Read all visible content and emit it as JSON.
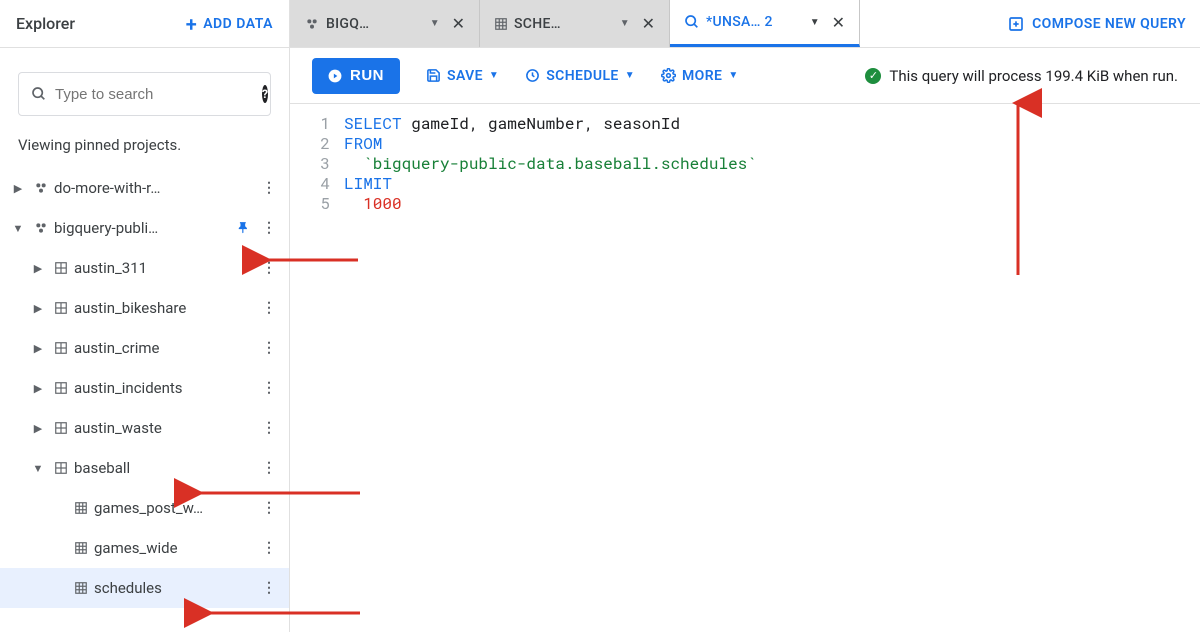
{
  "sidebar": {
    "title": "Explorer",
    "add_data": "ADD DATA",
    "search_placeholder": "Type to search",
    "viewing": "Viewing pinned projects.",
    "tree": [
      {
        "label": "do-more-with-r…",
        "icon": "project",
        "expanded": false,
        "indent": 0,
        "pinned": false
      },
      {
        "label": "bigquery-publi…",
        "icon": "project",
        "expanded": true,
        "indent": 0,
        "pinned": true
      },
      {
        "label": "austin_311",
        "icon": "dataset",
        "expanded": false,
        "indent": 1
      },
      {
        "label": "austin_bikeshare",
        "icon": "dataset",
        "expanded": false,
        "indent": 1
      },
      {
        "label": "austin_crime",
        "icon": "dataset",
        "expanded": false,
        "indent": 1
      },
      {
        "label": "austin_incidents",
        "icon": "dataset",
        "expanded": false,
        "indent": 1
      },
      {
        "label": "austin_waste",
        "icon": "dataset",
        "expanded": false,
        "indent": 1
      },
      {
        "label": "baseball",
        "icon": "dataset",
        "expanded": true,
        "indent": 1
      },
      {
        "label": "games_post_w…",
        "icon": "table",
        "indent": 2
      },
      {
        "label": "games_wide",
        "icon": "table",
        "indent": 2
      },
      {
        "label": "schedules",
        "icon": "table",
        "indent": 2,
        "selected": true
      }
    ]
  },
  "tabs": [
    {
      "label": "BIGQ…",
      "icon": "project",
      "active": false
    },
    {
      "label": "SCHE…",
      "icon": "table",
      "active": false
    },
    {
      "label": "*UNSA… 2",
      "icon": "query",
      "active": true
    }
  ],
  "compose_label": "COMPOSE NEW QUERY",
  "toolbar": {
    "run": "RUN",
    "save": "SAVE",
    "schedule": "SCHEDULE",
    "more": "MORE"
  },
  "status_text": "This query will process 199.4 KiB when run.",
  "editor": {
    "line_numbers": [
      "1",
      "2",
      "3",
      "4",
      "5"
    ],
    "lines": [
      [
        {
          "t": "SELECT",
          "c": "kw"
        },
        {
          "t": " gameId, gameNumber, seasonId",
          "c": "ident"
        }
      ],
      [
        {
          "t": "FROM",
          "c": "kw"
        }
      ],
      [
        {
          "t": "  `bigquery-public-data.baseball.schedules`",
          "c": "str"
        }
      ],
      [
        {
          "t": "LIMIT",
          "c": "kw"
        }
      ],
      [
        {
          "t": "  ",
          "c": "ident"
        },
        {
          "t": "1000",
          "c": "num"
        }
      ]
    ]
  },
  "colors": {
    "accent": "#1a73e8",
    "keyword": "#1a73e8",
    "string": "#188038",
    "number": "#d93025",
    "annotation": "#d93025"
  }
}
